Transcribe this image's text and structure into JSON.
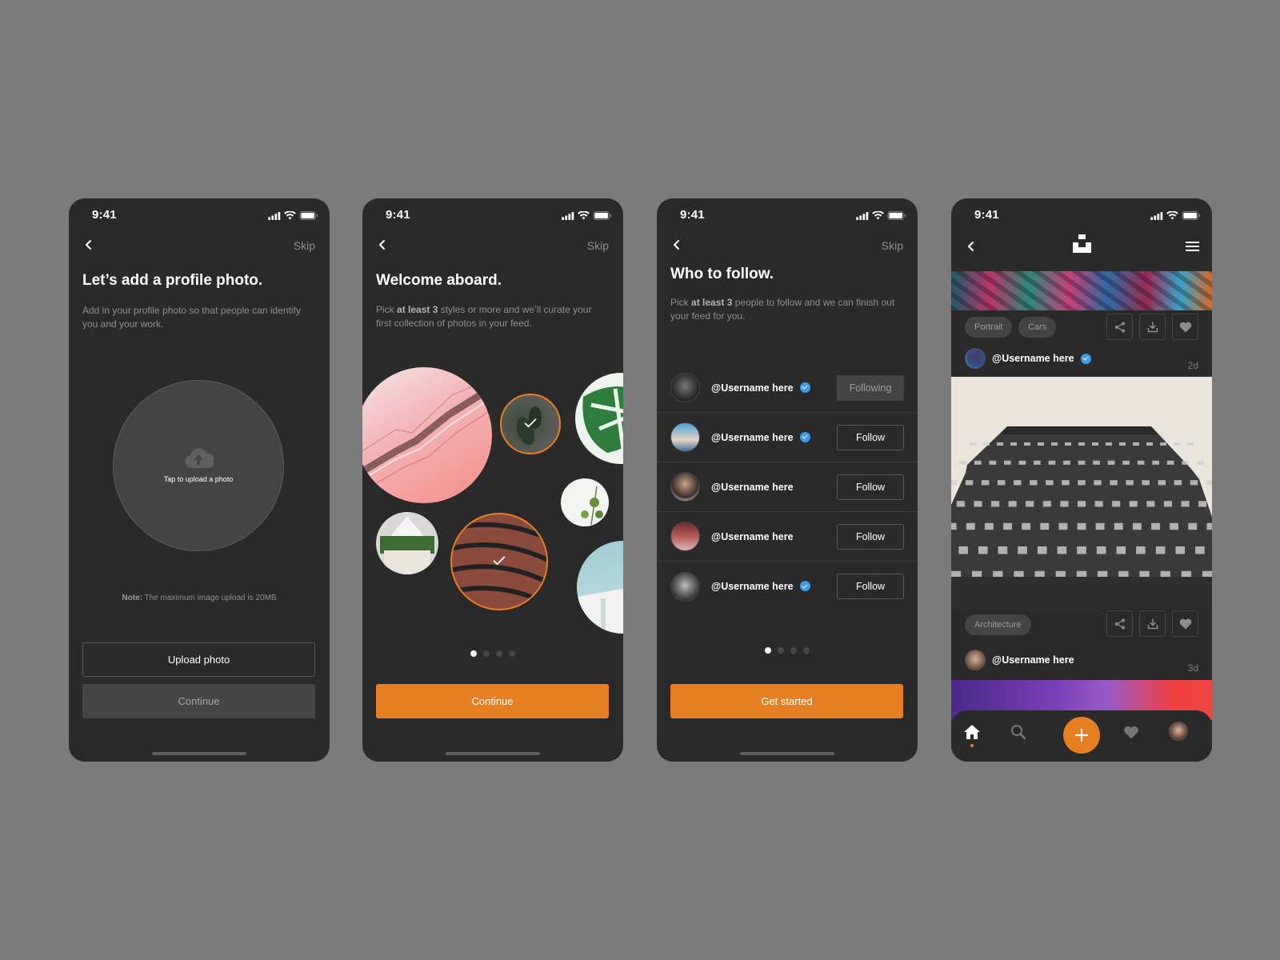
{
  "status_bar": {
    "time": "9:41"
  },
  "colors": {
    "accent": "#e67e22",
    "verified": "#3d9bea",
    "screen_bg": "#2a2a2a",
    "canvas_bg": "#7b7b7b"
  },
  "screen1": {
    "skip": "Skip",
    "title": "Let’s add a profile photo.",
    "description": "Add in your profile photo so that people can identify you and your work.",
    "upload_area_label": "Tap to upload a photo",
    "note_label": "Note:",
    "note_text": " The maximum image upload is 20MB",
    "upload_button": "Upload photo",
    "continue_button": "Continue"
  },
  "screen2": {
    "skip": "Skip",
    "title": "Welcome aboard.",
    "desc_pre": "Pick ",
    "desc_bold": "at least 3",
    "desc_post": " styles or more and we’ll curate your first collection of photos in your feed.",
    "styles": [
      {
        "name": "pink-architecture",
        "selected": false
      },
      {
        "name": "dark-plant",
        "selected": true
      },
      {
        "name": "monstera-leaf",
        "selected": false
      },
      {
        "name": "white-plant",
        "selected": false
      },
      {
        "name": "interior-plants",
        "selected": false
      },
      {
        "name": "brick-building",
        "selected": true
      },
      {
        "name": "sky-building",
        "selected": false
      }
    ],
    "page": 1,
    "pages": 4,
    "continue_button": "Continue"
  },
  "screen3": {
    "skip": "Skip",
    "title": "Who to follow.",
    "desc_pre": "Pick ",
    "desc_bold": "at least 3",
    "desc_post": " people to follow and we can finish out your feed for you.",
    "users": [
      {
        "username": "@Username here",
        "verified": true,
        "button": "Following"
      },
      {
        "username": "@Username here",
        "verified": true,
        "button": "Follow"
      },
      {
        "username": "@Username here",
        "verified": false,
        "button": "Follow"
      },
      {
        "username": "@Username here",
        "verified": false,
        "button": "Follow"
      },
      {
        "username": "@Username here",
        "verified": true,
        "button": "Follow"
      }
    ],
    "page": 1,
    "pages": 4,
    "cta_button": "Get started"
  },
  "screen4": {
    "posts": [
      {
        "tags": [
          "Portrait",
          "Cars"
        ],
        "username": "@Username here",
        "verified": true,
        "age": "2d"
      },
      {
        "tags": [
          "Architecture"
        ],
        "username": "@Username here",
        "verified": false,
        "age": "3d"
      }
    ],
    "tabbar": [
      "home",
      "search",
      "add",
      "likes",
      "profile"
    ]
  }
}
